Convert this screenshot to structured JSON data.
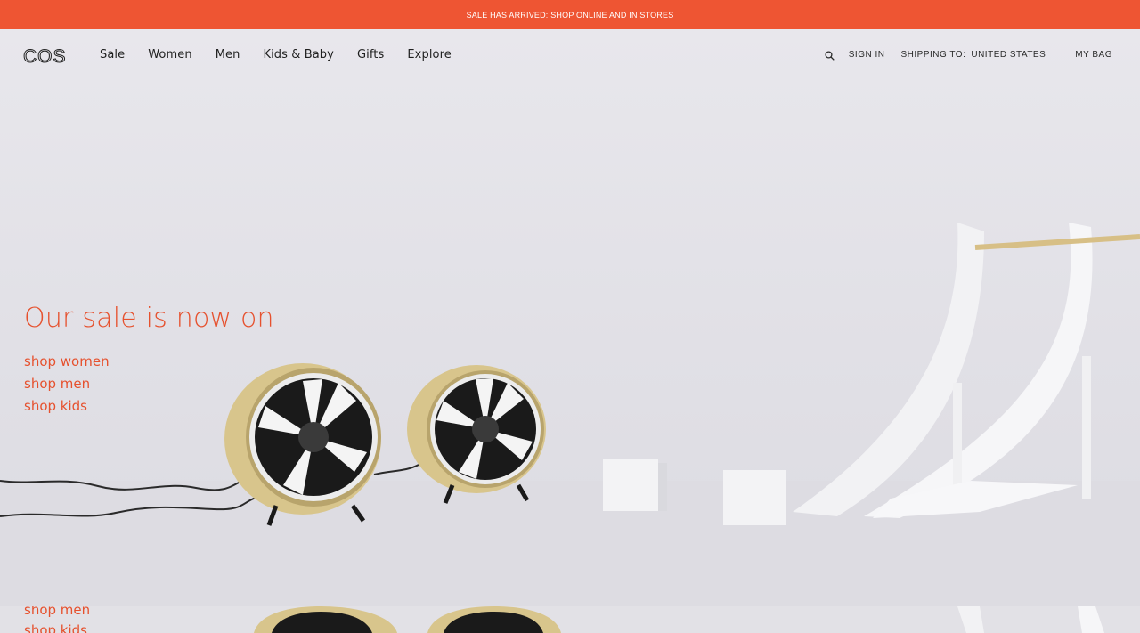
{
  "promo": {
    "text": "SALE HAS ARRIVED: SHOP ONLINE AND IN STORES"
  },
  "brand": {
    "logo_text": "COS"
  },
  "nav": {
    "items": [
      {
        "label": "Sale"
      },
      {
        "label": "Women"
      },
      {
        "label": "Men"
      },
      {
        "label": "Kids & Baby"
      },
      {
        "label": "Gifts"
      },
      {
        "label": "Explore"
      }
    ]
  },
  "utils": {
    "search_icon": "search-icon",
    "sign_in": "SIGN IN",
    "shipping_label": "SHIPPING TO:",
    "shipping_country": "UNITED STATES",
    "bag": "MY BAG"
  },
  "hero": {
    "title": "Our sale is now on",
    "links": [
      {
        "label": "shop women"
      },
      {
        "label": "shop men"
      },
      {
        "label": "shop kids"
      }
    ]
  },
  "peek": {
    "links": [
      {
        "label": "shop men"
      },
      {
        "label": "shop kids"
      }
    ]
  },
  "colors": {
    "accent": "#ee5533",
    "hero_text": "#e6512e",
    "text": "#1f1f1f",
    "background": "#e4e3e8"
  }
}
